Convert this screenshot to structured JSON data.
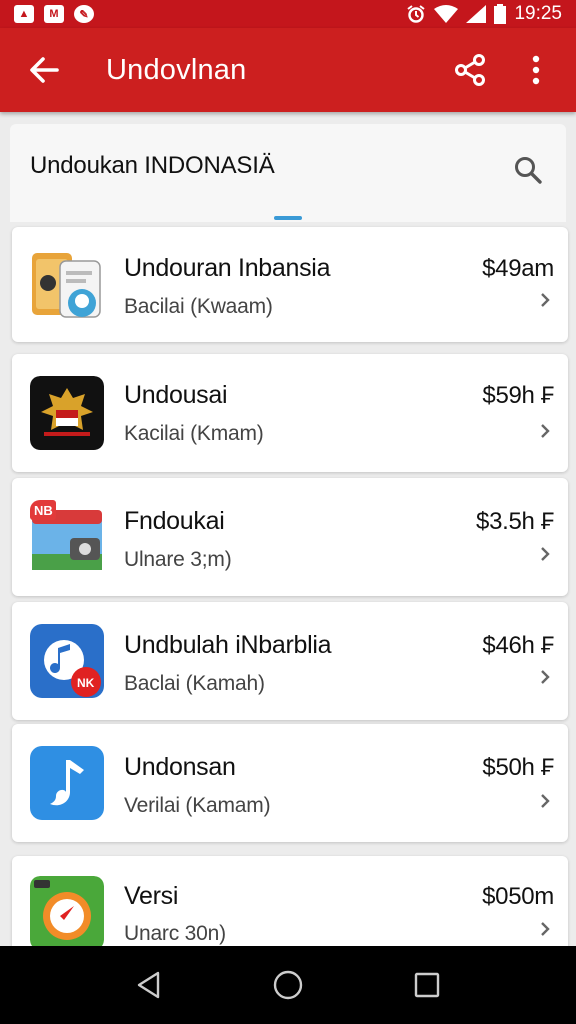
{
  "status_bar": {
    "time": "19:25",
    "left_icons": [
      "image-icon",
      "mail-icon",
      "compass-icon"
    ],
    "right_icons": [
      "alarm-icon",
      "wifi-icon",
      "signal-icon",
      "battery-icon"
    ]
  },
  "app_bar": {
    "title": "Undovlnan",
    "back_icon": "arrow-left-icon",
    "share_icon": "share-icon",
    "more_icon": "more-vert-icon",
    "color": "#cc1f1f"
  },
  "search": {
    "query": "Undoukan INDONASIÄ",
    "icon": "search-icon",
    "indicator_color": "#3a9ad6"
  },
  "items": [
    {
      "title": "Undouran Inbansia",
      "subtitle": "Bacilai (Kwaam)",
      "price": "$49am",
      "icon": "document-app-icon"
    },
    {
      "title": "Undousai",
      "subtitle": "Kacilai (Kmam)",
      "price": "$59h ₣",
      "icon": "garuda-app-icon"
    },
    {
      "title": "Fndoukai",
      "subtitle": "Ulnare 3;m)",
      "price": "$3.5h ₣",
      "icon": "folder-app-icon"
    },
    {
      "title": "Undbulah iNbarblia",
      "subtitle": "Baclai (Kamah)",
      "price": "$46h ₣",
      "icon": "music-app-icon"
    },
    {
      "title": "Undonsan",
      "subtitle": "Verilai (Kamam)",
      "price": "$50h ₣",
      "icon": "note-app-icon"
    },
    {
      "title": "Versi",
      "subtitle": "Unarc 30n)",
      "price": "$050m",
      "icon": "compass-app-icon"
    }
  ],
  "nav_bar": {
    "back_icon": "nav-back-icon",
    "home_icon": "nav-home-icon",
    "recents_icon": "nav-recents-icon"
  }
}
